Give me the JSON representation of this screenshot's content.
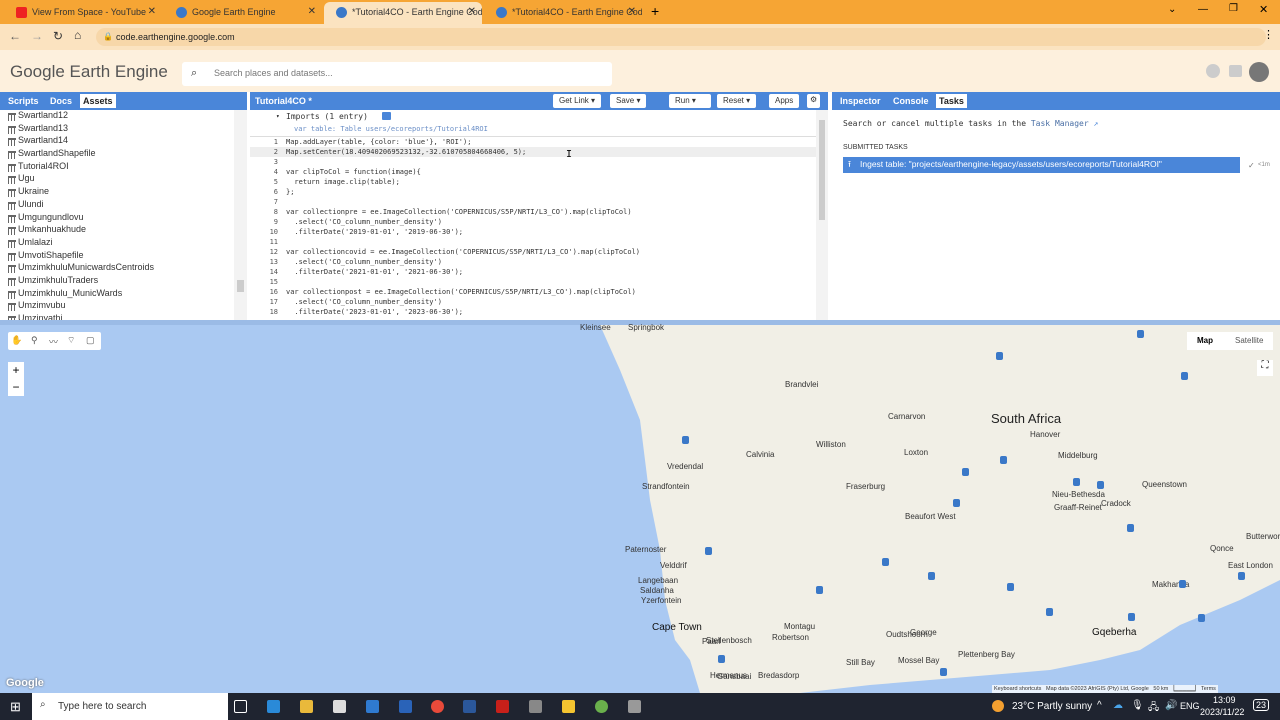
{
  "browser": {
    "tabs": [
      {
        "label": "View From Space - YouTube"
      },
      {
        "label": "Google Earth Engine"
      },
      {
        "label": "*Tutorial4CO - Earth Engine Cod"
      },
      {
        "label": "*Tutorial4CO - Earth Engine Cod"
      }
    ],
    "url": "code.earthengine.google.com",
    "active_tab": 2
  },
  "header": {
    "logo": "Google Earth Engine",
    "search_placeholder": "Search places and datasets..."
  },
  "left_panel": {
    "tabs": [
      "Scripts",
      "Docs",
      "Assets"
    ],
    "active": "Assets",
    "assets": [
      "Swartland12",
      "Swartland13",
      "Swartland14",
      "SwartlandShapefile",
      "Tutorial4ROI",
      "Ugu",
      "Ukraine",
      "Ulundi",
      "Umgungundlovu",
      "Umkanhuakhude",
      "Umlalazi",
      "UmvotiShapefile",
      "UmzimkhuluMunicwardsCentroids",
      "UmzimkhuluTraders",
      "Umzimkhulu_MunicWards",
      "Umzimvubu",
      "Umzinyathi"
    ]
  },
  "editor": {
    "title": "Tutorial4CO *",
    "buttons": {
      "get_link": "Get Link",
      "save": "Save",
      "run": "Run",
      "reset": "Reset",
      "apps": "Apps"
    },
    "imports_header": "Imports (1 entry)",
    "import_line": "var table: Table users/ecoreports/Tutorial4ROI",
    "lines": [
      "Map.addLayer(table, {color: 'blue'}, 'ROI');",
      "Map.setCenter(18.409402069523132,-32.610705804668406, 5);",
      "",
      "var clipToCol = function(image){",
      "  return image.clip(table);",
      "};",
      "",
      "var collectionpre = ee.ImageCollection('COPERNICUS/S5P/NRTI/L3_CO').map(clipToCol)",
      "  .select('CO_column_number_density')",
      "  .filterDate('2019-01-01', '2019-06-30');",
      "",
      "var collectioncovid = ee.ImageCollection('COPERNICUS/S5P/NRTI/L3_CO').map(clipToCol)",
      "  .select('CO_column_number_density')",
      "  .filterDate('2021-01-01', '2021-06-30');",
      "",
      "var collectionpost = ee.ImageCollection('COPERNICUS/S5P/NRTI/L3_CO').map(clipToCol)",
      "  .select('CO_column_number_density')",
      "  .filterDate('2023-01-01', '2023-06-30');"
    ]
  },
  "right_panel": {
    "tabs": [
      "Inspector",
      "Console",
      "Tasks"
    ],
    "active": "Tasks",
    "intro": "Search or cancel multiple tasks in the",
    "task_manager_link": "Task Manager",
    "section": "SUBMITTED TASKS",
    "task": "Ingest table: \"projects/earthengine-legacy/assets/users/ecoreports/Tutorial4ROI\"",
    "task_time": "<1m"
  },
  "map": {
    "type_buttons": [
      "Map",
      "Satellite"
    ],
    "active_type": "Map",
    "country_label": "South Africa",
    "places": [
      "Kleinsee",
      "Springbok",
      "Brandvlei",
      "Carnarvon",
      "Calvinia",
      "Williston",
      "Loxton",
      "Vredendal",
      "Strandfontein",
      "Fraserburg",
      "Beaufort West",
      "Paternoster",
      "Velddrif",
      "Langebaan",
      "Saldanha",
      "Yzerfontein",
      "Paarl",
      "Cape Town",
      "Stellenbosch",
      "Robertson",
      "Montagu",
      "Oudtshoorn",
      "George",
      "Still Bay",
      "Mossel Bay",
      "Plettenberg Bay",
      "Gqeberha",
      "Hanover",
      "Middelburg",
      "Nieu-Bethesda",
      "Graaff-Reinet",
      "Cradock",
      "Queenstown",
      "East London",
      "Makhanda",
      "Hermanus",
      "Gansbaai",
      "Bredasdorp",
      "Qonce",
      "Butterworth"
    ],
    "attribution": {
      "shortcuts": "Keyboard shortcuts",
      "data": "Map data ©2023 AfriGIS (Pty) Ltd, Google",
      "scale": "50 km",
      "terms": "Terms"
    },
    "google": "Google"
  },
  "taskbar": {
    "search_placeholder": "Type here to search",
    "weather": "23°C  Partly sunny",
    "lang": "ENG",
    "time": "13:09",
    "date": "2023/11/22",
    "notifications": "23"
  },
  "colors": {
    "accent": "#4a86d9",
    "browser_frame": "#f6a534",
    "water": "#aac9f2",
    "land": "#f1efe6"
  }
}
